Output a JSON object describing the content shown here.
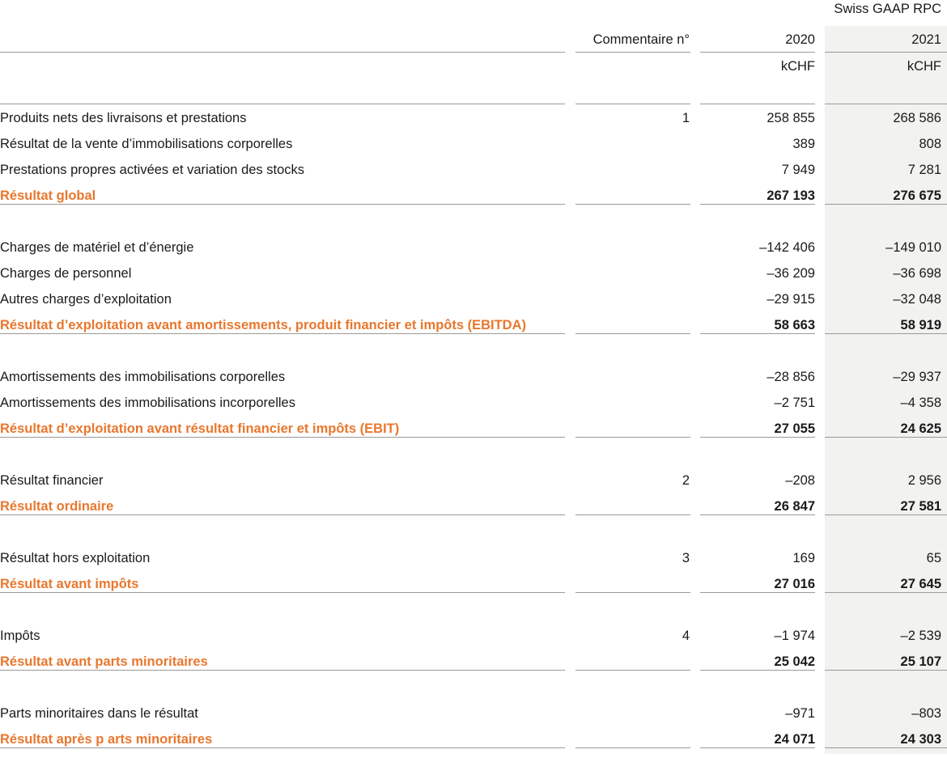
{
  "header": {
    "standard": "Swiss GAAP RPC",
    "col_comment": "Commentaire n°",
    "col_2020": "2020",
    "col_2021": "2021",
    "unit_2020": "kCHF",
    "unit_2021": "kCHF"
  },
  "rows": [
    {
      "label": "Produits nets des livraisons et prestations",
      "note": "1",
      "v2020": "258 855",
      "v2021": "268 586",
      "total": false
    },
    {
      "label": "Résultat de la vente d’immobilisations corporelles",
      "note": "",
      "v2020": "389",
      "v2021": "808",
      "total": false
    },
    {
      "label": "Prestations propres activées et variation des stocks",
      "note": "",
      "v2020": "7 949",
      "v2021": "7 281",
      "total": false
    },
    {
      "label": "Résultat global",
      "note": "",
      "v2020": "267 193",
      "v2021": "276 675",
      "total": true
    },
    {
      "label": "Charges de matériel et d’énergie",
      "note": "",
      "v2020": "–142 406",
      "v2021": "–149 010",
      "total": false
    },
    {
      "label": "Charges de personnel",
      "note": "",
      "v2020": "–36 209",
      "v2021": "–36 698",
      "total": false
    },
    {
      "label": "Autres charges d’exploitation",
      "note": "",
      "v2020": "–29 915",
      "v2021": "–32 048",
      "total": false
    },
    {
      "label": "Résultat d’exploitation avant amortissements, produit financier et impôts (EBITDA)",
      "note": "",
      "v2020": "58 663",
      "v2021": "58 919",
      "total": true
    },
    {
      "label": "Amortissements des immobilisations corporelles",
      "note": "",
      "v2020": "–28 856",
      "v2021": "–29 937",
      "total": false
    },
    {
      "label": "Amortissements des immobilisations incorporelles",
      "note": "",
      "v2020": "–2 751",
      "v2021": "–4 358",
      "total": false
    },
    {
      "label": "Résultat d’exploitation avant résultat financier et impôts (EBIT)",
      "note": "",
      "v2020": "27 055",
      "v2021": "24 625",
      "total": true
    },
    {
      "label": "Résultat financier",
      "note": "2",
      "v2020": "–208",
      "v2021": "2 956",
      "total": false
    },
    {
      "label": "Résultat ordinaire",
      "note": "",
      "v2020": "26 847",
      "v2021": "27 581",
      "total": true
    },
    {
      "label": "Résultat hors exploitation",
      "note": "3",
      "v2020": "169",
      "v2021": "65",
      "total": false
    },
    {
      "label": "Résultat avant impôts",
      "note": "",
      "v2020": "27 016",
      "v2021": "27 645",
      "total": true
    },
    {
      "label": "Impôts",
      "note": "4",
      "v2020": "–1 974",
      "v2021": "–2 539",
      "total": false
    },
    {
      "label": "Résultat avant parts minoritaires",
      "note": "",
      "v2020": "25 042",
      "v2021": "25 107",
      "total": true
    },
    {
      "label": "Parts minoritaires dans le résultat",
      "note": "",
      "v2020": "–971",
      "v2021": "–803",
      "total": false
    },
    {
      "label": "Résultat après p arts minoritaires",
      "note": "",
      "v2020": "24 071",
      "v2021": "24 303",
      "total": true
    }
  ]
}
